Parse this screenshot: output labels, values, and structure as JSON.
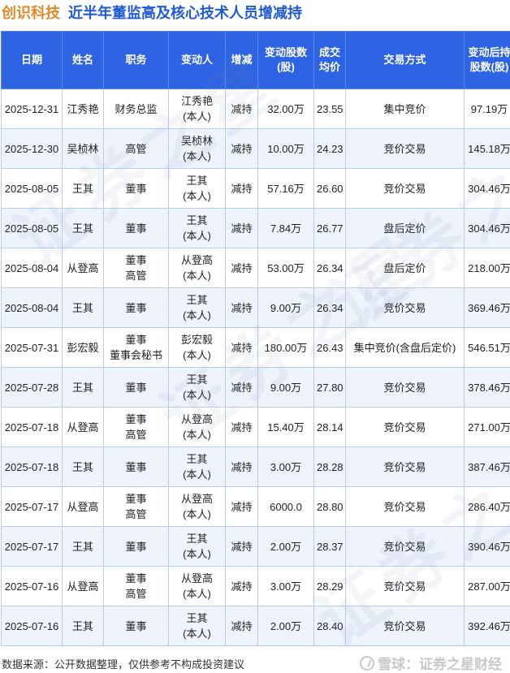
{
  "title": {
    "company": "创识科技",
    "main": "近半年董监高及核心技术人员增减持"
  },
  "columns": {
    "date": "日期",
    "name": "姓名",
    "position": "职务",
    "changer": "变动人",
    "direction": "增减",
    "shares": "变动股数(股)",
    "price": "成交均价",
    "method": "交易方式",
    "holding": "变动后持股数(股)"
  },
  "rows": [
    {
      "date": "2025-12-31",
      "name": "江秀艳",
      "position": "财务总监",
      "changer": "江秀艳",
      "changer_note": "(本人)",
      "direction": "减持",
      "shares": "32.00万",
      "price": "23.55",
      "method": "集中竞价",
      "holding": "97.19万"
    },
    {
      "date": "2025-12-30",
      "name": "吴桢林",
      "position": "高管",
      "changer": "吴桢林",
      "changer_note": "(本人)",
      "direction": "减持",
      "shares": "10.00万",
      "price": "24.23",
      "method": "竞价交易",
      "holding": "145.18万"
    },
    {
      "date": "2025-08-05",
      "name": "王其",
      "position": "董事",
      "changer": "王其",
      "changer_note": "(本人)",
      "direction": "减持",
      "shares": "57.16万",
      "price": "26.60",
      "method": "竞价交易",
      "holding": "304.46万"
    },
    {
      "date": "2025-08-05",
      "name": "王其",
      "position": "董事",
      "changer": "王其",
      "changer_note": "(本人)",
      "direction": "减持",
      "shares": "7.84万",
      "price": "26.77",
      "method": "盘后定价",
      "holding": "304.46万"
    },
    {
      "date": "2025-08-04",
      "name": "从登高",
      "position": "董事",
      "position2": "高管",
      "changer": "从登高",
      "changer_note": "(本人)",
      "direction": "减持",
      "shares": "53.00万",
      "price": "26.34",
      "method": "盘后定价",
      "holding": "218.00万"
    },
    {
      "date": "2025-08-04",
      "name": "王其",
      "position": "董事",
      "changer": "王其",
      "changer_note": "(本人)",
      "direction": "减持",
      "shares": "9.00万",
      "price": "26.34",
      "method": "竞价交易",
      "holding": "369.46万"
    },
    {
      "date": "2025-07-31",
      "name": "彭宏毅",
      "position": "董事",
      "position2": "董事会秘书",
      "changer": "彭宏毅",
      "changer_note": "(本人)",
      "direction": "减持",
      "shares": "180.00万",
      "price": "26.43",
      "method": "集中竞价(含盘后定价)",
      "holding": "546.51万"
    },
    {
      "date": "2025-07-28",
      "name": "王其",
      "position": "董事",
      "changer": "王其",
      "changer_note": "(本人)",
      "direction": "减持",
      "shares": "9.00万",
      "price": "27.80",
      "method": "竞价交易",
      "holding": "378.46万"
    },
    {
      "date": "2025-07-18",
      "name": "从登高",
      "position": "董事",
      "position2": "高管",
      "changer": "从登高",
      "changer_note": "(本人)",
      "direction": "减持",
      "shares": "15.40万",
      "price": "28.14",
      "method": "竞价交易",
      "holding": "271.00万"
    },
    {
      "date": "2025-07-18",
      "name": "王其",
      "position": "董事",
      "changer": "王其",
      "changer_note": "(本人)",
      "direction": "减持",
      "shares": "3.00万",
      "price": "28.28",
      "method": "竞价交易",
      "holding": "387.46万"
    },
    {
      "date": "2025-07-17",
      "name": "从登高",
      "position": "董事",
      "position2": "高管",
      "changer": "从登高",
      "changer_note": "(本人)",
      "direction": "减持",
      "shares": "6000.0",
      "price": "28.80",
      "method": "竞价交易",
      "holding": "286.40万"
    },
    {
      "date": "2025-07-17",
      "name": "王其",
      "position": "董事",
      "changer": "王其",
      "changer_note": "(本人)",
      "direction": "减持",
      "shares": "2.00万",
      "price": "28.37",
      "method": "竞价交易",
      "holding": "390.46万"
    },
    {
      "date": "2025-07-16",
      "name": "从登高",
      "position": "董事",
      "position2": "高管",
      "changer": "从登高",
      "changer_note": "(本人)",
      "direction": "减持",
      "shares": "3.00万",
      "price": "28.29",
      "method": "竞价交易",
      "holding": "287.00万"
    },
    {
      "date": "2025-07-16",
      "name": "王其",
      "position": "董事",
      "changer": "王其",
      "changer_note": "(本人)",
      "direction": "减持",
      "shares": "2.00万",
      "price": "28.40",
      "method": "竞价交易",
      "holding": "392.46万"
    }
  ],
  "footer": {
    "source": "数据来源：公开数据整理，仅供参考不构成投资建议",
    "brand": "雪球：证券之星财经"
  },
  "watermark": {
    "text": "证券之星"
  },
  "colors": {
    "header_bg": "#2e63e3",
    "title_company": "#e08a2b",
    "title_main": "#1f5bd6",
    "reduce_text": "#1b9a35"
  }
}
